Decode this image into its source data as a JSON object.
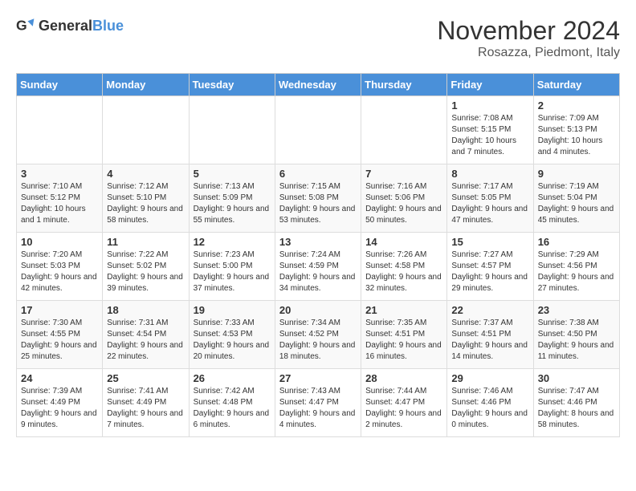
{
  "header": {
    "logo_general": "General",
    "logo_blue": "Blue",
    "month_title": "November 2024",
    "subtitle": "Rosazza, Piedmont, Italy"
  },
  "weekdays": [
    "Sunday",
    "Monday",
    "Tuesday",
    "Wednesday",
    "Thursday",
    "Friday",
    "Saturday"
  ],
  "weeks": [
    [
      {
        "day": "",
        "info": ""
      },
      {
        "day": "",
        "info": ""
      },
      {
        "day": "",
        "info": ""
      },
      {
        "day": "",
        "info": ""
      },
      {
        "day": "",
        "info": ""
      },
      {
        "day": "1",
        "info": "Sunrise: 7:08 AM\nSunset: 5:15 PM\nDaylight: 10 hours and 7 minutes."
      },
      {
        "day": "2",
        "info": "Sunrise: 7:09 AM\nSunset: 5:13 PM\nDaylight: 10 hours and 4 minutes."
      }
    ],
    [
      {
        "day": "3",
        "info": "Sunrise: 7:10 AM\nSunset: 5:12 PM\nDaylight: 10 hours and 1 minute."
      },
      {
        "day": "4",
        "info": "Sunrise: 7:12 AM\nSunset: 5:10 PM\nDaylight: 9 hours and 58 minutes."
      },
      {
        "day": "5",
        "info": "Sunrise: 7:13 AM\nSunset: 5:09 PM\nDaylight: 9 hours and 55 minutes."
      },
      {
        "day": "6",
        "info": "Sunrise: 7:15 AM\nSunset: 5:08 PM\nDaylight: 9 hours and 53 minutes."
      },
      {
        "day": "7",
        "info": "Sunrise: 7:16 AM\nSunset: 5:06 PM\nDaylight: 9 hours and 50 minutes."
      },
      {
        "day": "8",
        "info": "Sunrise: 7:17 AM\nSunset: 5:05 PM\nDaylight: 9 hours and 47 minutes."
      },
      {
        "day": "9",
        "info": "Sunrise: 7:19 AM\nSunset: 5:04 PM\nDaylight: 9 hours and 45 minutes."
      }
    ],
    [
      {
        "day": "10",
        "info": "Sunrise: 7:20 AM\nSunset: 5:03 PM\nDaylight: 9 hours and 42 minutes."
      },
      {
        "day": "11",
        "info": "Sunrise: 7:22 AM\nSunset: 5:02 PM\nDaylight: 9 hours and 39 minutes."
      },
      {
        "day": "12",
        "info": "Sunrise: 7:23 AM\nSunset: 5:00 PM\nDaylight: 9 hours and 37 minutes."
      },
      {
        "day": "13",
        "info": "Sunrise: 7:24 AM\nSunset: 4:59 PM\nDaylight: 9 hours and 34 minutes."
      },
      {
        "day": "14",
        "info": "Sunrise: 7:26 AM\nSunset: 4:58 PM\nDaylight: 9 hours and 32 minutes."
      },
      {
        "day": "15",
        "info": "Sunrise: 7:27 AM\nSunset: 4:57 PM\nDaylight: 9 hours and 29 minutes."
      },
      {
        "day": "16",
        "info": "Sunrise: 7:29 AM\nSunset: 4:56 PM\nDaylight: 9 hours and 27 minutes."
      }
    ],
    [
      {
        "day": "17",
        "info": "Sunrise: 7:30 AM\nSunset: 4:55 PM\nDaylight: 9 hours and 25 minutes."
      },
      {
        "day": "18",
        "info": "Sunrise: 7:31 AM\nSunset: 4:54 PM\nDaylight: 9 hours and 22 minutes."
      },
      {
        "day": "19",
        "info": "Sunrise: 7:33 AM\nSunset: 4:53 PM\nDaylight: 9 hours and 20 minutes."
      },
      {
        "day": "20",
        "info": "Sunrise: 7:34 AM\nSunset: 4:52 PM\nDaylight: 9 hours and 18 minutes."
      },
      {
        "day": "21",
        "info": "Sunrise: 7:35 AM\nSunset: 4:51 PM\nDaylight: 9 hours and 16 minutes."
      },
      {
        "day": "22",
        "info": "Sunrise: 7:37 AM\nSunset: 4:51 PM\nDaylight: 9 hours and 14 minutes."
      },
      {
        "day": "23",
        "info": "Sunrise: 7:38 AM\nSunset: 4:50 PM\nDaylight: 9 hours and 11 minutes."
      }
    ],
    [
      {
        "day": "24",
        "info": "Sunrise: 7:39 AM\nSunset: 4:49 PM\nDaylight: 9 hours and 9 minutes."
      },
      {
        "day": "25",
        "info": "Sunrise: 7:41 AM\nSunset: 4:49 PM\nDaylight: 9 hours and 7 minutes."
      },
      {
        "day": "26",
        "info": "Sunrise: 7:42 AM\nSunset: 4:48 PM\nDaylight: 9 hours and 6 minutes."
      },
      {
        "day": "27",
        "info": "Sunrise: 7:43 AM\nSunset: 4:47 PM\nDaylight: 9 hours and 4 minutes."
      },
      {
        "day": "28",
        "info": "Sunrise: 7:44 AM\nSunset: 4:47 PM\nDaylight: 9 hours and 2 minutes."
      },
      {
        "day": "29",
        "info": "Sunrise: 7:46 AM\nSunset: 4:46 PM\nDaylight: 9 hours and 0 minutes."
      },
      {
        "day": "30",
        "info": "Sunrise: 7:47 AM\nSunset: 4:46 PM\nDaylight: 8 hours and 58 minutes."
      }
    ]
  ],
  "colors": {
    "header_bg": "#4a90d9",
    "header_text": "#ffffff",
    "accent": "#4a90d9"
  }
}
